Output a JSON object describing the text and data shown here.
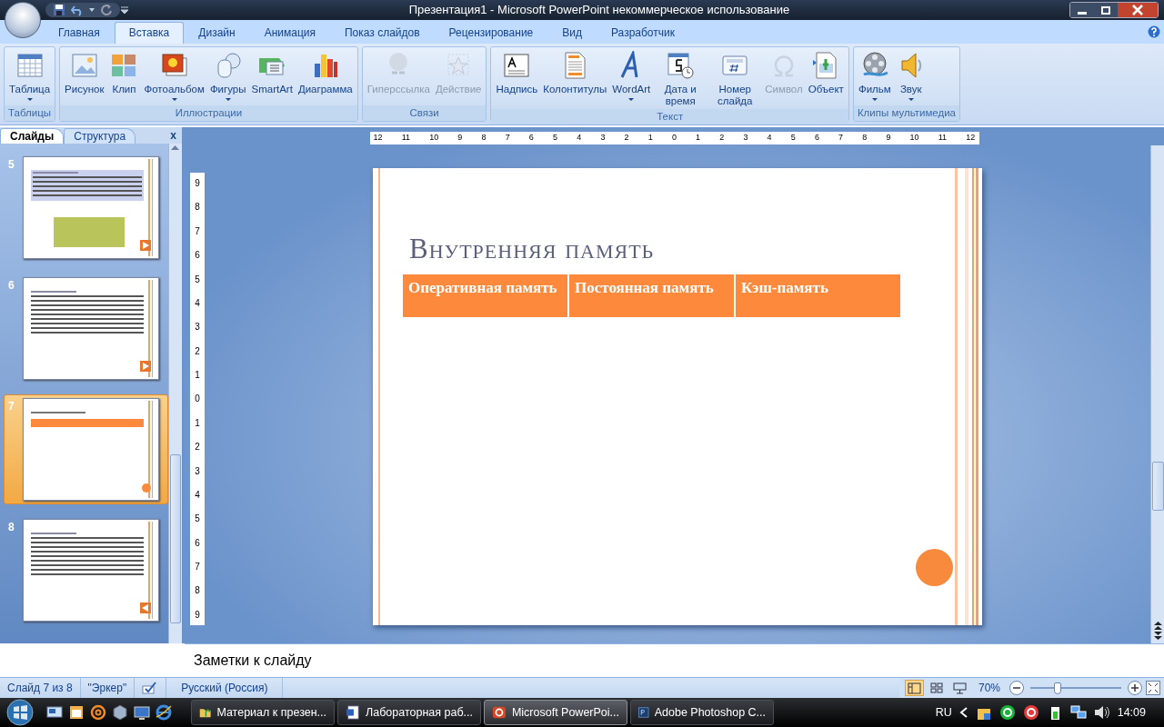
{
  "window": {
    "title": "Презентация1 - Microsoft PowerPoint некоммерческое использование"
  },
  "ribbon_tabs": [
    {
      "label": "Главная",
      "selected": false
    },
    {
      "label": "Вставка",
      "selected": true
    },
    {
      "label": "Дизайн",
      "selected": false
    },
    {
      "label": "Анимация",
      "selected": false
    },
    {
      "label": "Показ слайдов",
      "selected": false
    },
    {
      "label": "Рецензирование",
      "selected": false
    },
    {
      "label": "Вид",
      "selected": false
    },
    {
      "label": "Разработчик",
      "selected": false
    }
  ],
  "ribbon_groups": [
    {
      "label": "Таблицы",
      "buttons": [
        {
          "label": "Таблица",
          "kind": "table",
          "dropdown": true,
          "disabled": false
        }
      ]
    },
    {
      "label": "Иллюстрации",
      "buttons": [
        {
          "label": "Рисунок",
          "kind": "picture",
          "dropdown": false,
          "disabled": false
        },
        {
          "label": "Клип",
          "kind": "clip",
          "dropdown": false,
          "disabled": false
        },
        {
          "label": "Фотоальбом",
          "kind": "album",
          "dropdown": true,
          "disabled": false
        },
        {
          "label": "Фигуры",
          "kind": "shapes",
          "dropdown": true,
          "disabled": false
        },
        {
          "label": "SmartArt",
          "kind": "smartart",
          "dropdown": false,
          "disabled": false
        },
        {
          "label": "Диаграмма",
          "kind": "chart",
          "dropdown": false,
          "disabled": false
        }
      ]
    },
    {
      "label": "Связи",
      "buttons": [
        {
          "label": "Гиперссылка",
          "kind": "globe",
          "dropdown": false,
          "disabled": true
        },
        {
          "label": "Действие",
          "kind": "action",
          "dropdown": false,
          "disabled": true
        }
      ]
    },
    {
      "label": "Текст",
      "buttons": [
        {
          "label": "Надпись",
          "kind": "textbox",
          "dropdown": false,
          "disabled": false
        },
        {
          "label": "Колонтитулы",
          "kind": "page",
          "dropdown": false,
          "disabled": false
        },
        {
          "label": "WordArt",
          "kind": "wordart",
          "dropdown": true,
          "disabled": false
        },
        {
          "label": "Дата и время",
          "kind": "calendar",
          "dropdown": false,
          "disabled": false
        },
        {
          "label": "Номер слайда",
          "kind": "number",
          "dropdown": false,
          "disabled": false
        },
        {
          "label": "Символ",
          "kind": "omega",
          "dropdown": false,
          "disabled": true
        },
        {
          "label": "Объект",
          "kind": "object",
          "dropdown": false,
          "disabled": false
        }
      ]
    },
    {
      "label": "Клипы мультимедиа",
      "buttons": [
        {
          "label": "Фильм",
          "kind": "film",
          "dropdown": true,
          "disabled": false
        },
        {
          "label": "Звук",
          "kind": "speaker",
          "dropdown": true,
          "disabled": false
        }
      ]
    }
  ],
  "slides_panel": {
    "tabs": [
      {
        "label": "Слайды",
        "selected": true
      },
      {
        "label": "Структура",
        "selected": false
      }
    ],
    "close": "x",
    "thumbnails": [
      {
        "number": "5",
        "selected": false,
        "kind": "photo_next"
      },
      {
        "number": "6",
        "selected": false,
        "kind": "bullets_next"
      },
      {
        "number": "7",
        "selected": true,
        "kind": "table_circle"
      },
      {
        "number": "8",
        "selected": false,
        "kind": "bullets_prev"
      }
    ]
  },
  "rulers": {
    "horizontal": [
      "12",
      "11",
      "10",
      "9",
      "8",
      "7",
      "6",
      "5",
      "4",
      "3",
      "2",
      "1",
      "0",
      "1",
      "2",
      "3",
      "4",
      "5",
      "6",
      "7",
      "8",
      "9",
      "10",
      "11",
      "12"
    ],
    "vertical": [
      "9",
      "8",
      "7",
      "6",
      "5",
      "4",
      "3",
      "2",
      "1",
      "0",
      "1",
      "2",
      "3",
      "4",
      "5",
      "6",
      "7",
      "8",
      "9"
    ]
  },
  "slide": {
    "title": "Внутренняя память",
    "table_header": [
      "Оперативная память",
      "Постоянная память",
      "Кэш-память"
    ]
  },
  "notes": {
    "placeholder": "Заметки к слайду"
  },
  "status_bar": {
    "slide": "Слайд 7 из 8",
    "theme": "\"Эркер\"",
    "language": "Русский (Россия)",
    "views": [
      {
        "kind": "normal",
        "selected": true
      },
      {
        "kind": "sorter",
        "selected": false
      },
      {
        "kind": "show",
        "selected": false
      }
    ],
    "zoom": "70%",
    "zoom_slider": {
      "level": 0.3
    }
  },
  "taskbar": {
    "tasks": [
      {
        "label": "Материал к презен...",
        "kind": "folder",
        "selected": false
      },
      {
        "label": "Лабораторная раб...",
        "kind": "word",
        "selected": false
      },
      {
        "label": "Microsoft PowerPoi...",
        "kind": "powerpoint",
        "selected": true
      },
      {
        "label": "Adobe Photoshop C...",
        "kind": "photoshop",
        "selected": false
      }
    ],
    "language": "RU",
    "time": "14:09"
  }
}
